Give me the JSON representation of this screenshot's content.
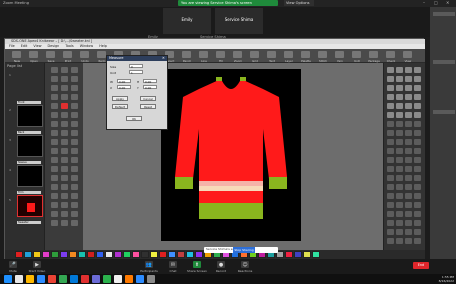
{
  "zoom": {
    "window_title": "Zoom Meeting",
    "banner_text": "You are viewing Service Shima's screen",
    "view_options": "View Options",
    "participants": [
      {
        "name": "Emily"
      },
      {
        "name": "Service Shima"
      }
    ],
    "speaker_labels": [
      "Emily",
      "Service Shima"
    ],
    "controls": [
      {
        "label": "Mute",
        "icon": "microphone-icon"
      },
      {
        "label": "Start Video",
        "icon": "video-camera-icon"
      },
      {
        "label": "Participants",
        "icon": "people-icon"
      },
      {
        "label": "Chat",
        "icon": "chat-icon"
      },
      {
        "label": "Share Screen",
        "icon": "share-screen-icon"
      },
      {
        "label": "Record",
        "icon": "record-icon"
      },
      {
        "label": "Reactions",
        "icon": "smiley-icon"
      }
    ],
    "share_text": "Service Shima's screen",
    "stop_share": "Stop Sharing",
    "end_label": "End"
  },
  "app": {
    "title": "SDS-ONE Apex4 Knitwear – [ D:\\…\\Sweater.kni ]",
    "menus": [
      "File",
      "Edit",
      "View",
      "Design",
      "Tools",
      "Window",
      "Help"
    ],
    "toolbar": [
      "New",
      "Open",
      "Save",
      "Print",
      "Undo",
      "Redo",
      "Cut",
      "Copy",
      "Paste",
      "Select",
      "Pencil",
      "Line",
      "Fill",
      "Zoom",
      "Grid",
      "Text",
      "Layer",
      "Palette",
      "Stitch",
      "Yarn",
      "Knit",
      "Package",
      "Check",
      "View"
    ],
    "pages_panel_title": "Page list",
    "pages": [
      {
        "label": "Front"
      },
      {
        "label": "Back"
      },
      {
        "label": "Sleeve"
      },
      {
        "label": "Trim"
      },
      {
        "label": "Sweater"
      }
    ],
    "page_numbers": [
      "1",
      "2",
      "3",
      "4",
      "5"
    ]
  },
  "dialog": {
    "title": "Measure",
    "rows": [
      {
        "label": "Size",
        "value": "0"
      },
      {
        "label": "Unit",
        "value": "1"
      }
    ],
    "fields": [
      {
        "label": "W",
        "value": "0.00"
      },
      {
        "label": "H",
        "value": "0.00"
      },
      {
        "label": "X",
        "value": "0.00"
      },
      {
        "label": "Y",
        "value": "0.00"
      }
    ],
    "buttons": [
      "Apply",
      "Cancel",
      "Default",
      "Reset"
    ],
    "ok": "OK"
  },
  "colors": {
    "body_red": "#ff1a1a",
    "rib_green": "#8ab51e",
    "stripe_pink": "#f5b2a8",
    "stripe_peach": "#f7d9b8",
    "canvas_black": "#000000",
    "zoom_green": "#1f8a3b",
    "end_red": "#e0262b"
  },
  "swatches": [
    "#e02020",
    "#21a0d8",
    "#f0c818",
    "#e03cc8",
    "#2e9c3b",
    "#7c3cf0",
    "#f08820",
    "#18c0b0",
    "#d02020",
    "#3060f0",
    "#e8e8e8",
    "#b030d0",
    "#20d060",
    "#ff50a0",
    "#303030",
    "#f0f040",
    "#e02020",
    "#4090ff",
    "#c04040",
    "#20c0e0",
    "#9030f0",
    "#f0a000",
    "#30b050",
    "#e050e0",
    "#2070e0",
    "#ff7030",
    "#70d020",
    "#c020a0",
    "#1fa0a0",
    "#a0a0a0",
    "#f02040",
    "#4040c0",
    "#e0e050",
    "#30e0a0"
  ],
  "taskbar": {
    "clock_time": "1:55 PM",
    "clock_date": "8/16/2022"
  }
}
